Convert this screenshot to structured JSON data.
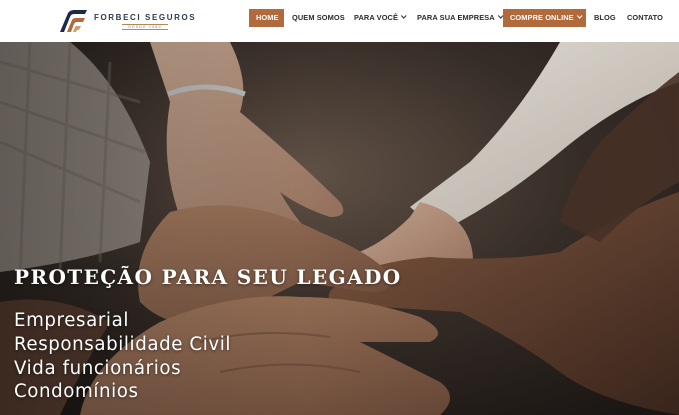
{
  "brand": {
    "name": "FORBECI SEGUROS",
    "tagline": "DESDE 1980",
    "logo_icon": "forbeci-logo-icon",
    "colors": {
      "navy": "#1e2a45",
      "copper": "#b06a3b"
    }
  },
  "nav": {
    "items": [
      {
        "label": "HOME",
        "active": true
      },
      {
        "label": "QUEM SOMOS"
      },
      {
        "label": "PARA VOCÊ",
        "dropdown": true
      },
      {
        "label": "PARA SUA EMPRESA",
        "dropdown": true
      },
      {
        "label": "COMPRE ONLINE",
        "dropdown": true,
        "highlight": true
      },
      {
        "label": "BLOG"
      },
      {
        "label": "CONTATO"
      }
    ]
  },
  "hero": {
    "image": "stacked-hands-photo",
    "title": "PROTEÇÃO PARA SEU LEGADO",
    "services": [
      "Empresarial",
      "Responsabilidade Civil",
      "Vida funcionários",
      "Condomínios"
    ]
  }
}
